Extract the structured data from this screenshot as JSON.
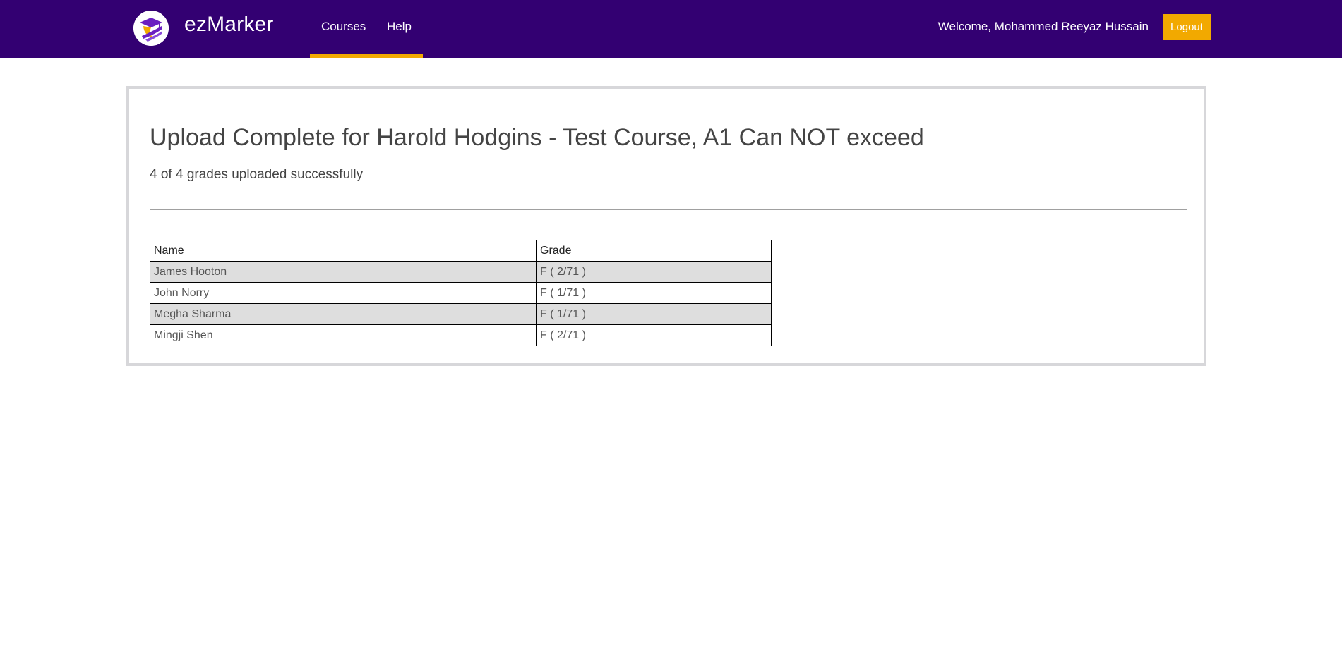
{
  "header": {
    "brand": "ezMarker",
    "logo_icon": "graduate-logo-icon",
    "nav": [
      {
        "label": "Courses",
        "active": true
      },
      {
        "label": "Help",
        "active": false
      }
    ],
    "welcome": "Welcome, Mohammed Reeyaz Hussain",
    "logout_label": "Logout"
  },
  "main": {
    "title": "Upload Complete for Harold Hodgins - Test Course, A1 Can NOT exceed",
    "subtitle": "4 of 4 grades uploaded successfully",
    "table": {
      "columns": [
        "Name",
        "Grade"
      ],
      "rows": [
        {
          "name": "James Hooton",
          "grade": "F ( 2/71 )"
        },
        {
          "name": "John Norry",
          "grade": "F ( 1/71 )"
        },
        {
          "name": "Megha Sharma",
          "grade": "F ( 1/71 )"
        },
        {
          "name": "Mingji Shen",
          "grade": "F ( 2/71 )"
        }
      ]
    }
  },
  "colors": {
    "header_bg": "#330072",
    "accent": "#f2a900",
    "panel_border": "#d7d7da",
    "row_shade": "#dedede"
  }
}
